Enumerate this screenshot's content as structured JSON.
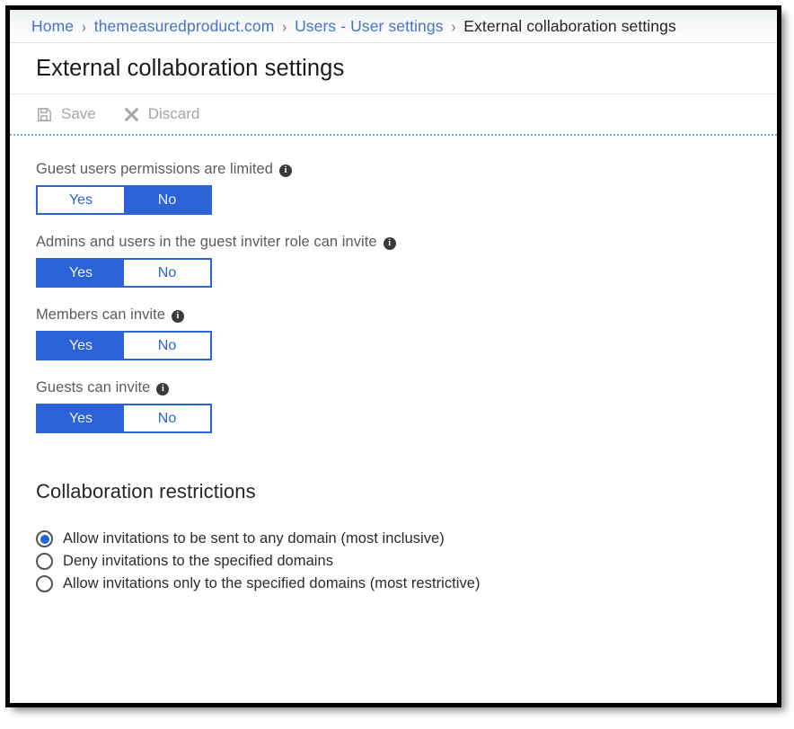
{
  "breadcrumb": {
    "separator": "›",
    "items": [
      {
        "label": "Home",
        "current": false
      },
      {
        "label": "themeasuredproduct.com",
        "current": false
      },
      {
        "label": "Users - User settings",
        "current": false
      },
      {
        "label": "External collaboration settings",
        "current": true
      }
    ]
  },
  "header": {
    "title": "External collaboration settings"
  },
  "toolbar": {
    "save_label": "Save",
    "save_icon": "save-floppy-icon",
    "save_enabled": false,
    "discard_label": "Discard",
    "discard_icon": "close-x-icon",
    "discard_enabled": false
  },
  "settings": {
    "info_glyph": "i",
    "options": [
      {
        "yes": "Yes",
        "no": "No"
      }
    ],
    "items": [
      {
        "label": "Guest users permissions are limited",
        "yes_label": "Yes",
        "no_label": "No",
        "value": "No"
      },
      {
        "label": "Admins and users in the guest inviter role can invite",
        "yes_label": "Yes",
        "no_label": "No",
        "value": "Yes"
      },
      {
        "label": "Members can invite",
        "yes_label": "Yes",
        "no_label": "No",
        "value": "Yes"
      },
      {
        "label": "Guests can invite",
        "yes_label": "Yes",
        "no_label": "No",
        "value": "Yes"
      }
    ]
  },
  "collaboration_restrictions": {
    "heading": "Collaboration restrictions",
    "selected_index": 0,
    "options": [
      {
        "label": "Allow invitations to be sent to any domain (most inclusive)",
        "selected": true
      },
      {
        "label": "Deny invitations to the specified domains",
        "selected": false
      },
      {
        "label": "Allow invitations only to the specified domains (most restrictive)",
        "selected": false
      }
    ]
  },
  "colors": {
    "accent_blue": "#2b62d6",
    "link_blue": "#4a72c4",
    "radio_blue": "#1f63d8",
    "divider_blue": "#66b9e8",
    "label_grey": "#5c5c5c",
    "disabled_grey": "#a6a6a6"
  }
}
